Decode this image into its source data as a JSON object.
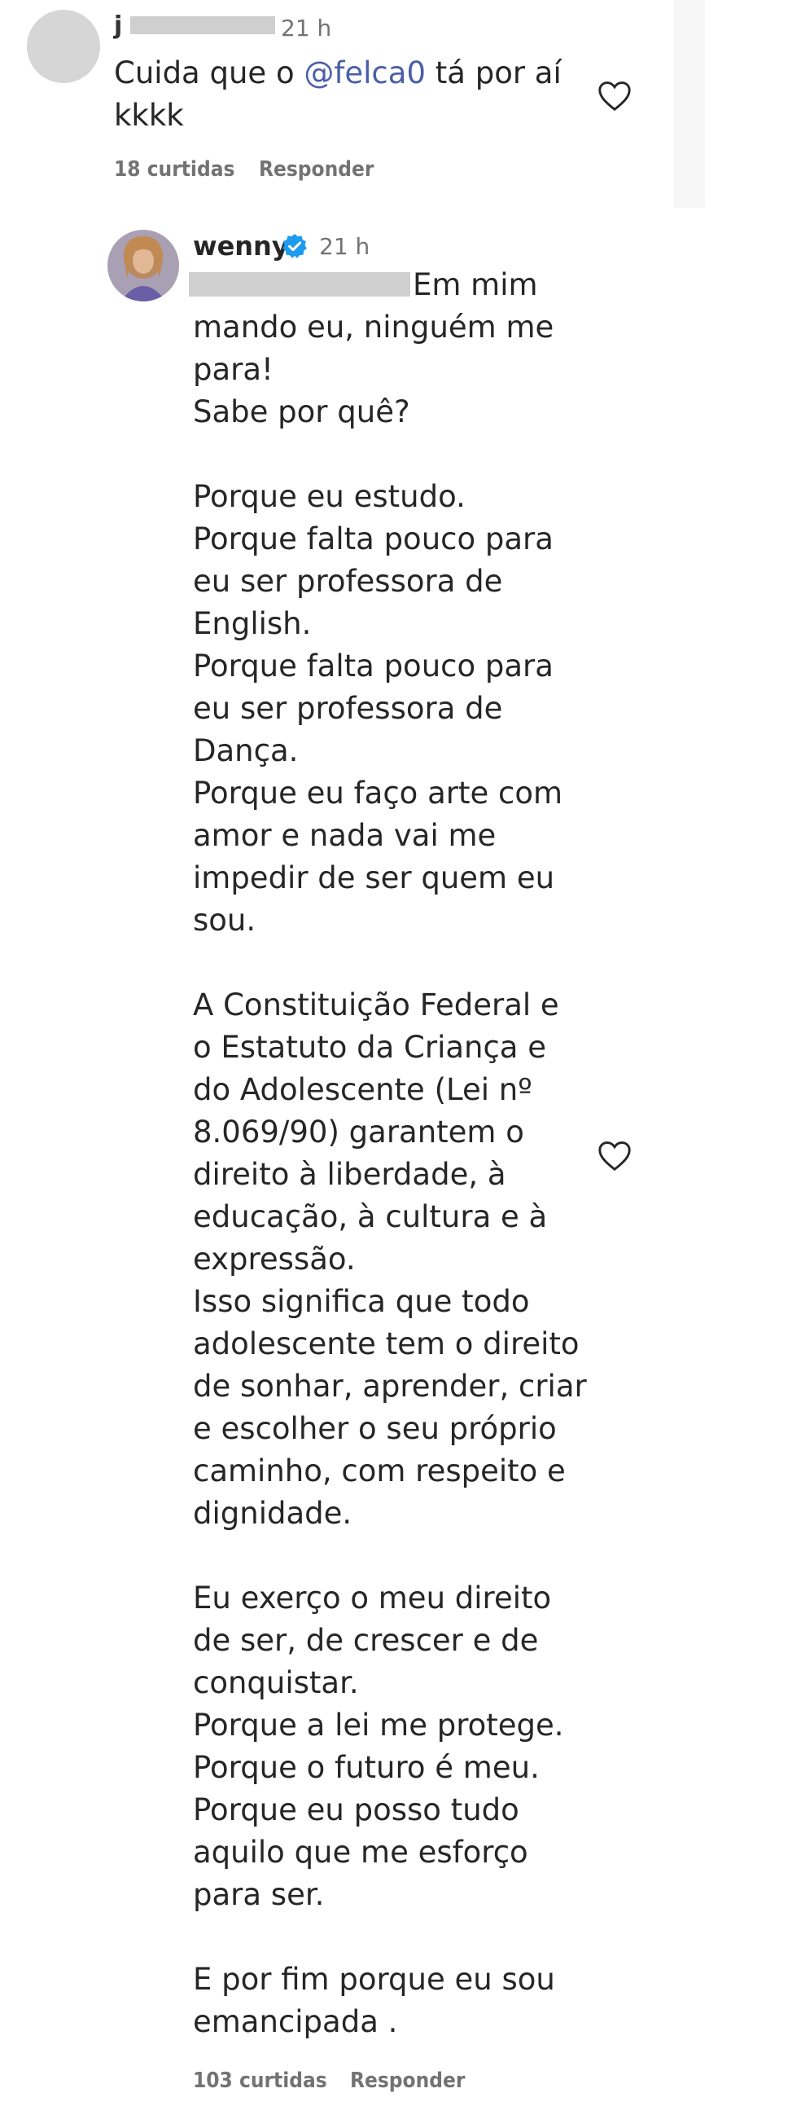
{
  "comment1": {
    "username": "j",
    "time": "21 h",
    "mention": "@felca0",
    "text_before": "Cuida que o ",
    "text_after": " tá por aí\nkkkk",
    "likes": "18 curtidas",
    "reply": "Responder",
    "icon": "heart-outline-icon"
  },
  "comment2": {
    "username": "wenny",
    "time": "21 h",
    "first_line_after_redaction": "Em mim",
    "text": "mando eu, ninguém me\npara!\nSabe por quê?\n\nPorque eu estudo.\nPorque falta pouco para\neu ser professora de\nEnglish.\nPorque falta pouco para\neu ser professora de\nDança.\nPorque eu faço arte com\namor e nada vai me\nimpedir de ser quem eu\nsou.\n\nA Constituição Federal e\no Estatuto da Criança e\ndo Adolescente (Lei nº\n8.069/90) garantem o\ndireito à liberdade, à\neducação, à cultura e à\nexpressão.\nIsso significa que todo\nadolescente tem o direito\nde sonhar, aprender, criar\ne escolher o seu próprio\ncaminho, com respeito e\ndignidade.\n\nEu exerço o meu direito\nde ser, de crescer e de\nconquistar.\nPorque a lei me protege.\nPorque o futuro é meu.\nPorque eu posso tudo\naquilo que me esforço\npara ser.\n\nE por fim porque eu sou\nemancipada .",
    "likes": "103 curtidas",
    "reply": "Responder",
    "verified_icon": "verified-badge-icon",
    "icon": "heart-outline-icon"
  },
  "colors": {
    "text": "#262626",
    "secondary": "#737373",
    "mention": "#4a5fa8",
    "verified": "#1d9bf0"
  }
}
